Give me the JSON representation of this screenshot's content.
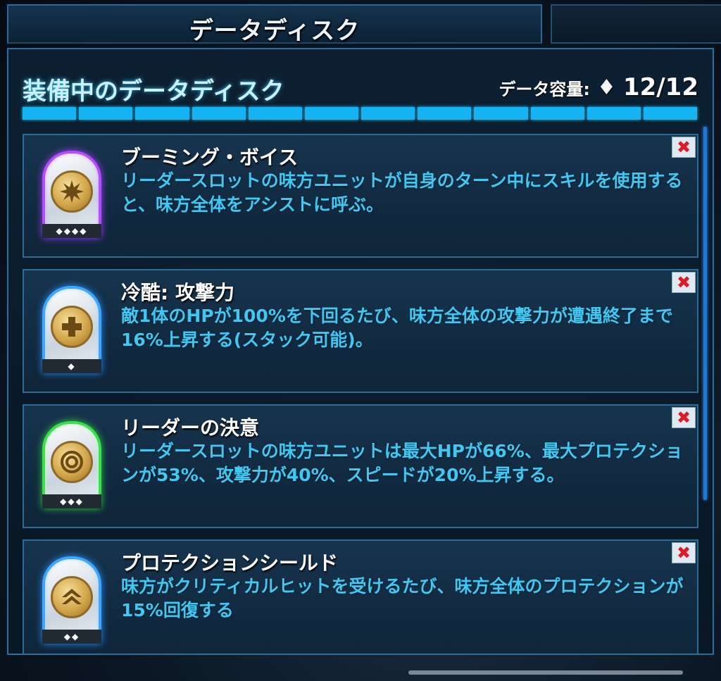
{
  "tabs": {
    "active_title": "データディスク"
  },
  "section": {
    "title": "装備中のデータディスク",
    "capacity_label": "データ容量:",
    "capacity_icon": "diamond-icon",
    "capacity_value": "12/12",
    "capacity_used": 12,
    "capacity_total": 12
  },
  "cards": [
    {
      "name": "ブーミング・ボイス",
      "description": "リーダースロットの味方ユニットが自身のターン中にスキルを使用すると、味方全体をアシストに呼ぶ。",
      "frame": "purple",
      "icon": "burst-icon",
      "rank": "◆◆◆◆"
    },
    {
      "name": "冷酷: 攻撃力",
      "description": "敵1体のHPが100%を下回るたび、味方全体の攻撃力が遭遇終了まで16%上昇する(スタック可能)。",
      "frame": "blue",
      "icon": "plus-icon",
      "rank": "◆"
    },
    {
      "name": "リーダーの決意",
      "description": "リーダースロットの味方ユニットは最大HPが66%、最大プロテクションが53%、攻撃力が40%、スピードが20%上昇する。",
      "frame": "green",
      "icon": "rings-icon",
      "rank": "◆◆◆"
    },
    {
      "name": "プロテクションシールド",
      "description": "味方がクリティカルヒットを受けるたび、味方全体のプロテクションが15%回復する",
      "frame": "blue",
      "icon": "chevron-up-icon",
      "rank": "◆◆"
    }
  ],
  "remove_symbol": "✖",
  "colors": {
    "accent": "#14b4f2",
    "description_text": "#40c8f2",
    "remove_x": "#e0182a"
  }
}
